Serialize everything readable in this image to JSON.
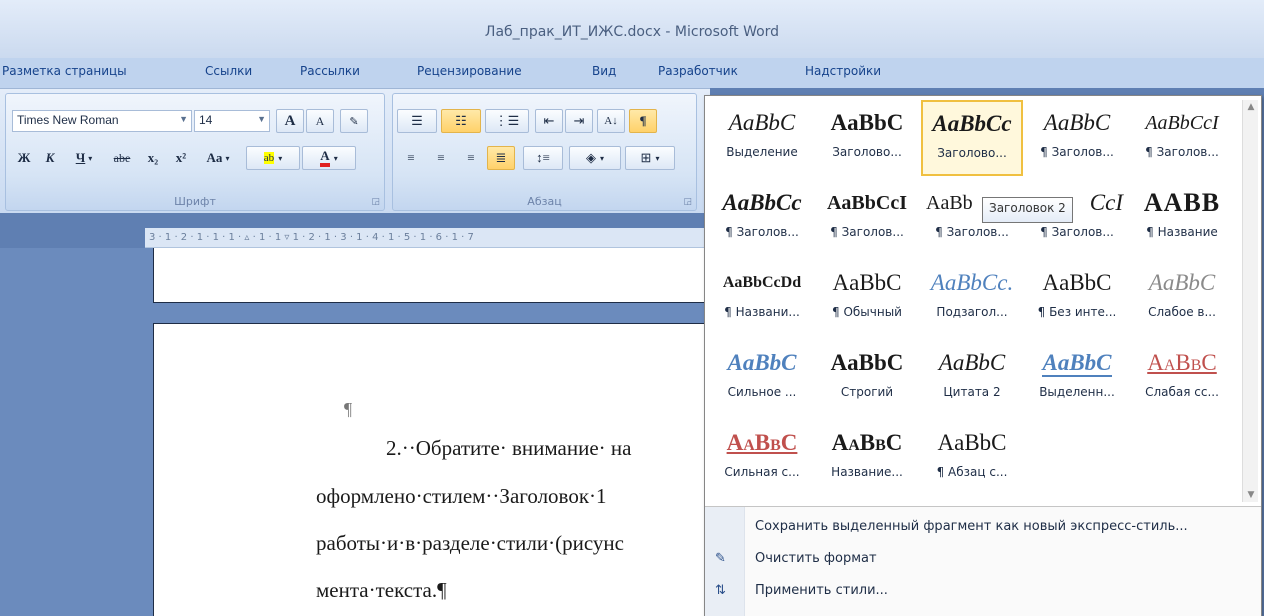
{
  "window": {
    "title": "Лаб_прак_ИТ_ИЖС.docx - Microsoft Word"
  },
  "tabs": [
    "Разметка страницы",
    "Ссылки",
    "Рассылки",
    "Рецензирование",
    "Вид",
    "Разработчик",
    "Надстройки"
  ],
  "ribbon": {
    "font_group": {
      "label": "Шрифт",
      "font_name": "Times New Roman",
      "font_size": "14",
      "grow_label": "A",
      "shrink_label": "A",
      "bold_label": "Ж",
      "italic_label": "К",
      "underline_label": "Ч",
      "strike_label": "abe",
      "subscript_label": "x₂",
      "superscript_label": "x²",
      "case_label": "Aa",
      "highlight_label": "ab",
      "fontcolor_label": "A"
    },
    "paragraph_group": {
      "label": "Абзац"
    }
  },
  "ruler": {
    "text": "3 · 1 · 2 · 1 · 1 · 1 · ▵ · 1 · 1 ▿ 1 · 2 · 1 · 3 · 1 · 4 · 1 · 5 · 1 · 6 · 1 · 7"
  },
  "document": {
    "pilcrow": "¶",
    "line1": "2.··Обратите· внимание· на",
    "line2": "оформлено·стилем··Заголовок·1",
    "line3": "работы·и·в·разделе·стили·(рисунс",
    "line4": "мента·текста.¶"
  },
  "styles_gallery": {
    "styles": [
      {
        "sample": "AaBbC",
        "name": "Выделение"
      },
      {
        "sample": "AaBbC",
        "name": "Заголово..."
      },
      {
        "sample": "AaBbCc",
        "name": "Заголово..."
      },
      {
        "sample": "AaBbC",
        "name": "¶ Заголов..."
      },
      {
        "sample": "AaBbCcI",
        "name": "¶ Заголов..."
      },
      {
        "sample": "AaBbCc",
        "name": "¶ Заголов..."
      },
      {
        "sample": "AaBbCcI",
        "name": "¶ Заголов..."
      },
      {
        "sample": "AaBb",
        "name": "¶ Заголов..."
      },
      {
        "sample": "CcI",
        "name": "¶ Заголов..."
      },
      {
        "sample": "AABB",
        "name": "¶ Название"
      },
      {
        "sample": "AaBbCcDd",
        "name": "¶ Названи..."
      },
      {
        "sample": "AaBbC",
        "name": "¶ Обычный"
      },
      {
        "sample": "AaBbCc.",
        "name": "Подзагол..."
      },
      {
        "sample": "AaBbC",
        "name": "¶ Без инте..."
      },
      {
        "sample": "AaBbC",
        "name": "Слабое в..."
      },
      {
        "sample": "AaBbC",
        "name": "Сильное ..."
      },
      {
        "sample": "AaBbC",
        "name": "Строгий"
      },
      {
        "sample": "AaBbC",
        "name": "Цитата 2"
      },
      {
        "sample": "AaBbC",
        "name": "Выделенн..."
      },
      {
        "sample": "AaBbC",
        "name": "Слабая сс..."
      },
      {
        "sample": "AaBbC",
        "name": "Сильная с..."
      },
      {
        "sample": "AaBbC",
        "name": "Название..."
      },
      {
        "sample": "AaBbC",
        "name": "¶ Абзац с..."
      }
    ],
    "tooltip": "Заголовок 2",
    "menu": {
      "save_as_new": "Сохранить выделенный фрагмент как новый экспресс-стиль...",
      "clear_format": "Очистить формат",
      "apply_styles": "Применить стили..."
    }
  }
}
